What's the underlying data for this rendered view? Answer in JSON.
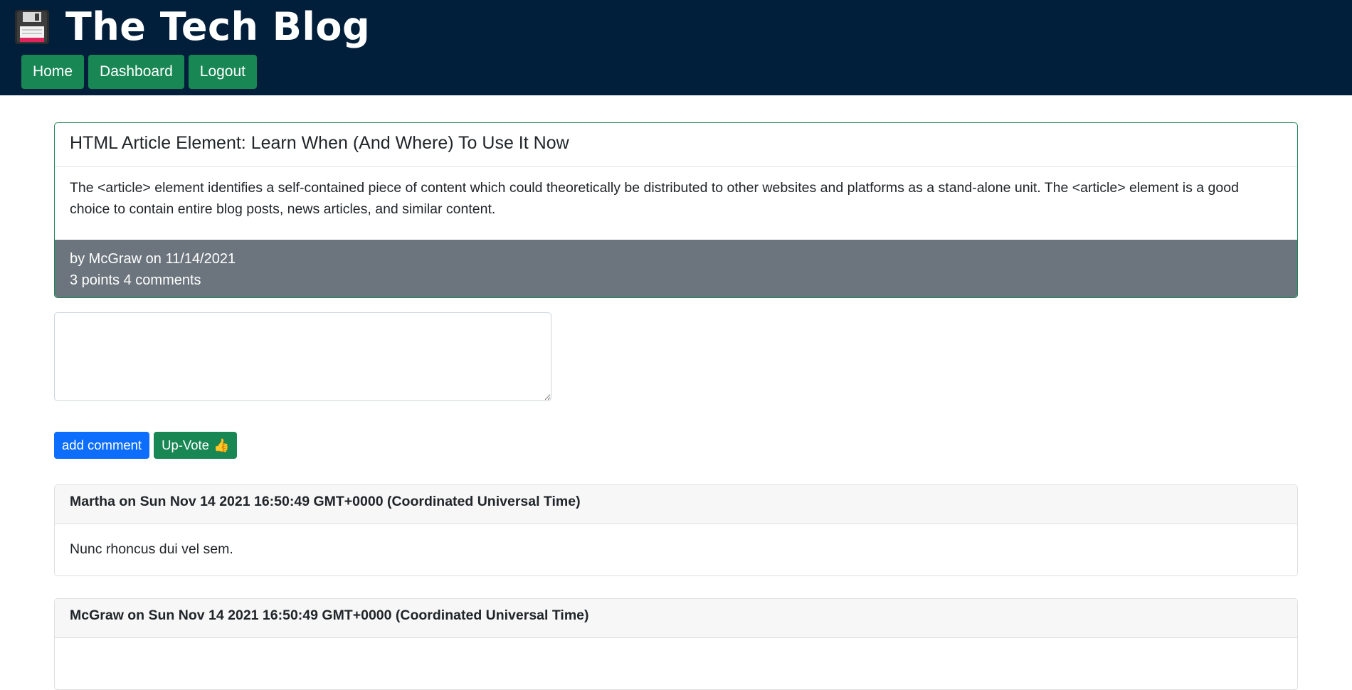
{
  "header": {
    "site_title": "The Tech Blog",
    "logo_icon": "floppy-disk-icon",
    "background_color": "#011f3b",
    "nav": [
      {
        "label": "Home"
      },
      {
        "label": "Dashboard"
      },
      {
        "label": "Logout"
      }
    ]
  },
  "post": {
    "title": "HTML Article Element: Learn When (And Where) To Use It Now",
    "body": "The <article> element identifies a self-contained piece of content which could theoretically be distributed to other websites and platforms as a stand-alone unit. The <article> element is a good choice to contain entire blog posts, news articles, and similar content.",
    "byline": "by McGraw on 11/14/2021",
    "stats": "3 points 4 comments"
  },
  "comment_form": {
    "value": "",
    "add_label": "add comment",
    "upvote_label": "Up-Vote",
    "upvote_icon": "thumbs-up-icon"
  },
  "comments": [
    {
      "header": "Martha on Sun Nov 14 2021 16:50:49 GMT+0000 (Coordinated Universal Time)",
      "body": "Nunc rhoncus dui vel sem."
    },
    {
      "header": "McGraw on Sun Nov 14 2021 16:50:49 GMT+0000 (Coordinated Universal Time)",
      "body": ""
    }
  ],
  "colors": {
    "accent_green": "#198754",
    "primary_blue": "#0d6efd",
    "footer_gray": "#6c757d"
  }
}
